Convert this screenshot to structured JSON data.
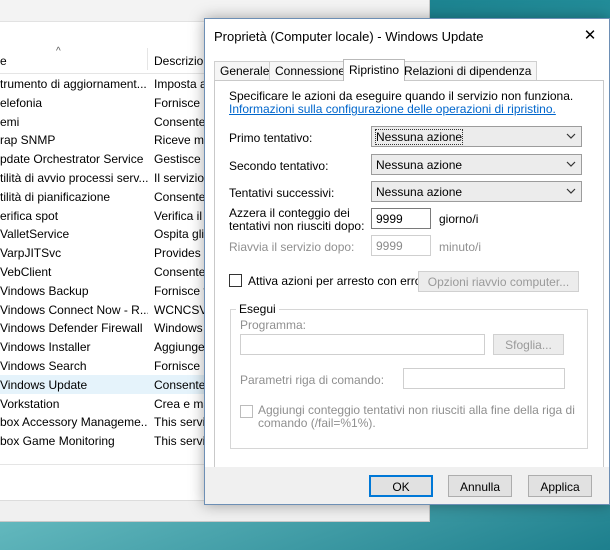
{
  "services_window": {
    "columns": {
      "name": "e",
      "description": "Descrizion"
    },
    "rows": [
      {
        "name": "trumento di aggiornament...",
        "desc": "Imposta a"
      },
      {
        "name": "elefonia",
        "desc": "Fornisce i"
      },
      {
        "name": "emi",
        "desc": "Consente"
      },
      {
        "name": "rap SNMP",
        "desc": "Riceve me"
      },
      {
        "name": "pdate Orchestrator Service",
        "desc": "Gestisce g"
      },
      {
        "name": "tilità di avvio processi serv...",
        "desc": "Il servizio"
      },
      {
        "name": "tilità di pianificazione",
        "desc": "Consente"
      },
      {
        "name": "erifica spot",
        "desc": "Verifica il"
      },
      {
        "name": "ValletService",
        "desc": "Ospita gli"
      },
      {
        "name": "VarpJITSvc",
        "desc": "Provides a"
      },
      {
        "name": "VebClient",
        "desc": "Consente"
      },
      {
        "name": "Vindows Backup",
        "desc": "Fornisce f"
      },
      {
        "name": "Vindows Connect Now - R...",
        "desc": "WCNCSVC"
      },
      {
        "name": "Vindows Defender Firewall",
        "desc": "Windows"
      },
      {
        "name": "Vindows Installer",
        "desc": "Aggiunge"
      },
      {
        "name": "Vindows Search",
        "desc": "Fornisce i"
      },
      {
        "name": "Vindows Update",
        "desc": "Consente"
      },
      {
        "name": "Vorkstation",
        "desc": "Crea e ma"
      },
      {
        "name": "box Accessory Manageme...",
        "desc": "This servi"
      },
      {
        "name": "box Game Monitoring",
        "desc": "This servi"
      }
    ]
  },
  "dialog": {
    "title": "Proprietà (Computer locale) - Windows Update",
    "close_glyph": "✕",
    "tabs": [
      "Generale",
      "Connessione",
      "Ripristino",
      "Relazioni di dipendenza"
    ],
    "active_tab": "Ripristino",
    "intro_text": "Specificare le azioni da eseguire quando il servizio non funziona.",
    "intro_link": "Informazioni sulla configurazione delle operazioni di ripristino.",
    "first_attempt": {
      "label": "Primo tentativo:",
      "value": "Nessuna azione"
    },
    "second_attempt": {
      "label": "Secondo tentativo:",
      "value": "Nessuna azione"
    },
    "subsequent_attempts": {
      "label": "Tentativi successivi:",
      "value": "Nessuna azione"
    },
    "reset_counter": {
      "label_line1": "Azzera il conteggio dei",
      "label_line2": "tentativi non riusciti dopo:",
      "value": "9999",
      "unit": "giorno/i"
    },
    "restart_service": {
      "label": "Riavvia il servizio dopo:",
      "value": "9999",
      "unit": "minuto/i"
    },
    "stop_actions_checkbox": "Attiva azioni per arresto con errori.",
    "restart_options_button": "Opzioni riavvio computer...",
    "run_group": {
      "title": "Esegui",
      "program_label": "Programma:",
      "program_value": "",
      "browse_button": "Sfoglia...",
      "params_label": "Parametri riga di comando:",
      "params_value": "",
      "append_checkbox_line1": "Aggiungi conteggio tentativi non riusciti alla fine della riga di",
      "append_checkbox_line2": "comando (/fail=%1%)."
    },
    "footer": {
      "ok": "OK",
      "cancel": "Annulla",
      "apply": "Applica"
    }
  },
  "colors": {
    "accent": "#0078d7",
    "link": "#0066cc",
    "selection": "#e5f3fb",
    "desktop": "#2a97a3"
  }
}
